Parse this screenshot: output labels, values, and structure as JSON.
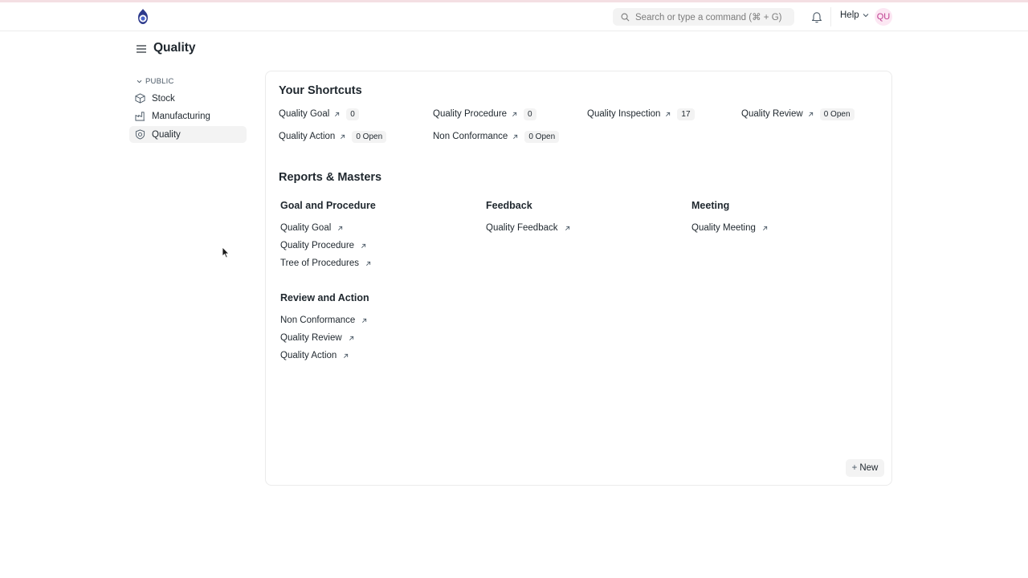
{
  "navbar": {
    "search_placeholder": "Search or type a command (⌘ + G)",
    "help_label": "Help",
    "avatar_initials": "QU",
    "accent_color": "#be3c8f"
  },
  "page": {
    "title": "Quality"
  },
  "sidebar": {
    "group_label": "PUBLIC",
    "items": [
      {
        "label": "Stock",
        "icon": "box-icon"
      },
      {
        "label": "Manufacturing",
        "icon": "factory-icon"
      },
      {
        "label": "Quality",
        "icon": "shield-icon",
        "active": true
      }
    ]
  },
  "shortcuts": {
    "title": "Your Shortcuts",
    "items": [
      {
        "label": "Quality Goal",
        "count": "0"
      },
      {
        "label": "Quality Procedure",
        "count": "0"
      },
      {
        "label": "Quality Inspection",
        "count": "17"
      },
      {
        "label": "Quality Review",
        "count": "0 Open"
      },
      {
        "label": "Quality Action",
        "count": "0 Open"
      },
      {
        "label": "Non Conformance",
        "count": "0 Open"
      }
    ]
  },
  "reports": {
    "title": "Reports & Masters",
    "columns": [
      {
        "title": "Goal and Procedure",
        "links": [
          "Quality Goal",
          "Quality Procedure",
          "Tree of Procedures"
        ]
      },
      {
        "title": "Feedback",
        "links": [
          "Quality Feedback"
        ]
      },
      {
        "title": "Meeting",
        "links": [
          "Quality Meeting"
        ]
      },
      {
        "title": "Review and Action",
        "links": [
          "Non Conformance",
          "Quality Review",
          "Quality Action"
        ]
      }
    ]
  },
  "actions": {
    "new_label": "New"
  }
}
